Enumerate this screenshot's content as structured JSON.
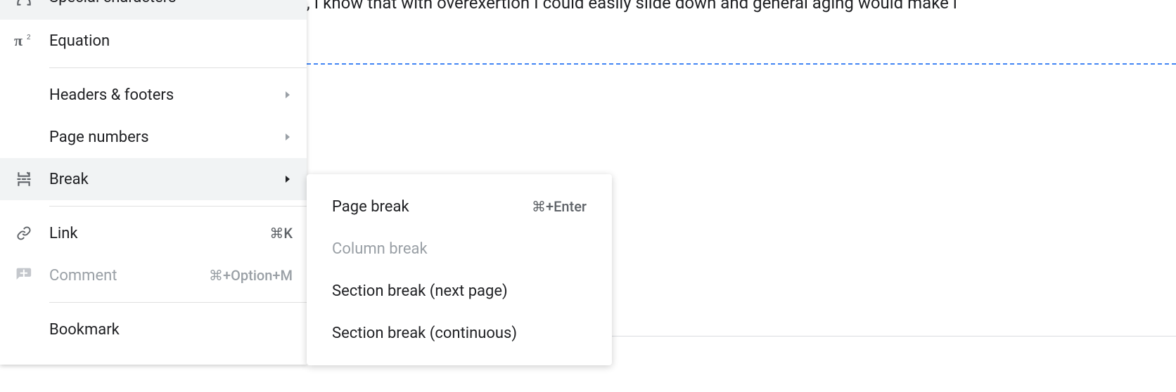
{
  "document": {
    "visible_text": ", I know that with overexertion I could easily slide down and general aging would make i"
  },
  "menu": {
    "items": {
      "special_characters": {
        "label": "Special characters"
      },
      "equation": {
        "label": "Equation"
      },
      "headers_footers": {
        "label": "Headers & footers"
      },
      "page_numbers": {
        "label": "Page numbers"
      },
      "break": {
        "label": "Break"
      },
      "link": {
        "label": "Link",
        "shortcut": "⌘K"
      },
      "comment": {
        "label": "Comment",
        "shortcut": "⌘+Option+M"
      },
      "bookmark": {
        "label": "Bookmark"
      }
    }
  },
  "submenu": {
    "items": {
      "page_break": {
        "label": "Page break",
        "shortcut": "⌘+Enter"
      },
      "column_break": {
        "label": "Column break"
      },
      "section_break_next": {
        "label": "Section break (next page)"
      },
      "section_break_continuous": {
        "label": "Section break (continuous)"
      }
    }
  }
}
